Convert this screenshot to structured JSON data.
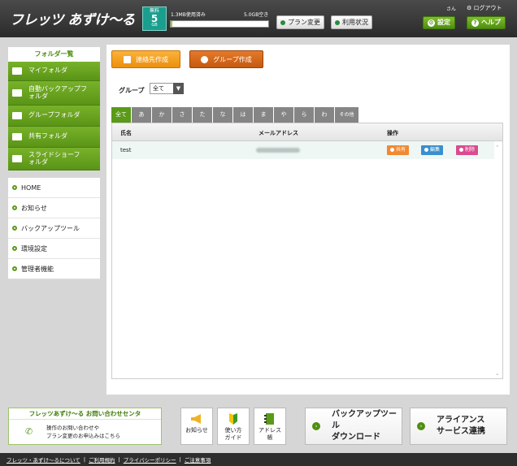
{
  "header": {
    "logo": "フレッツ あずけ〜る",
    "plan": {
      "top": "無料",
      "value": "5",
      "unit": "GB"
    },
    "usage_used": "1.3MB使用済み",
    "usage_total": "5.0GB空き",
    "usage_fraction": 0.02,
    "plan_change_label": "プラン変更",
    "usage_status_label": "利用状況",
    "user_name": "さん",
    "logout_label": "ログアウト",
    "settings_label": "設定",
    "help_label": "ヘルプ"
  },
  "sidebar": {
    "folder_heading": "フォルダ一覧",
    "folders": [
      {
        "label": "マイフォルダ"
      },
      {
        "label": "自動バックアップフォルダ"
      },
      {
        "label": "グループフォルダ"
      },
      {
        "label": "共有フォルダ"
      },
      {
        "label": "スライドショーフォルダ"
      }
    ],
    "nav": [
      {
        "label": "HOME"
      },
      {
        "label": "お知らせ"
      },
      {
        "label": "バックアップツール"
      },
      {
        "label": "環境設定"
      },
      {
        "label": "管理者機能"
      }
    ]
  },
  "main": {
    "create_contact_label": "連絡先作成",
    "create_group_label": "グループ作成",
    "group_label": "グループ",
    "group_value": "全て",
    "tabs": [
      "全て",
      "あ",
      "か",
      "さ",
      "た",
      "な",
      "は",
      "ま",
      "や",
      "ら",
      "わ",
      "その他"
    ],
    "active_tab": 0,
    "columns": {
      "name": "氏名",
      "email": "メールアドレス",
      "ops": "操作"
    },
    "rows": [
      {
        "name": "test",
        "actions": {
          "share": "共有",
          "edit": "編集",
          "delete": "削除"
        }
      }
    ]
  },
  "footer": {
    "contact_title": "フレッツあずけ〜る お問い合わせセンタ",
    "contact_line1": "操作のお問い合わせや",
    "contact_line2": "プラン変更のお申込みはこちら",
    "news_label": "お知らせ",
    "guide_line1": "使い方",
    "guide_line2": "ガイド",
    "address_line1": "アドレス",
    "address_line2": "帳",
    "backup_line1": "バックアップツール",
    "backup_line2": "ダウンロード",
    "alliance_line1": "アライアンス",
    "alliance_line2": "サービス連携",
    "links": [
      "フレッツ・あずけ〜るについて",
      "ご利用規約",
      "プライバシーポリシー",
      "ご注意事項"
    ]
  }
}
